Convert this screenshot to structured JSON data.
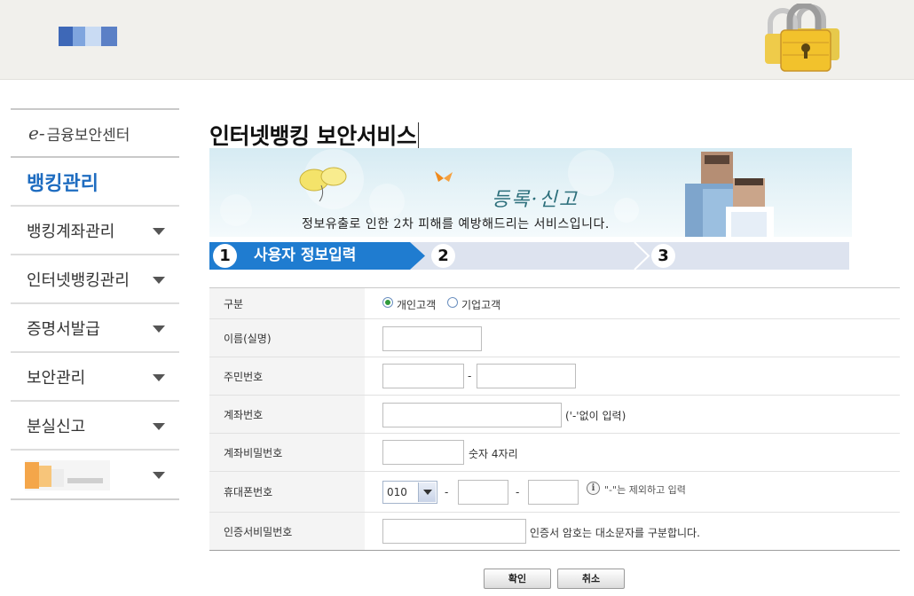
{
  "header": {
    "logo_icon": "kfta-logo",
    "lock_icon": "padlock-icon"
  },
  "sidebar": {
    "heading_prefix": "e-",
    "heading": "금융보안센터",
    "section_title": "뱅킹관리",
    "items": [
      {
        "label": "뱅킹계좌관리"
      },
      {
        "label": "인터넷뱅킹관리"
      },
      {
        "label": "증명서발급"
      },
      {
        "label": "보안관리"
      },
      {
        "label": "분실신고"
      }
    ],
    "banner_icon": "site-banner"
  },
  "main": {
    "title": "인터넷뱅킹 보안서비스",
    "hero": {
      "heading": "등록·신고",
      "description": "정보유출로 인한 2차 피해를 예방해드리는 서비스입니다."
    },
    "steps": [
      {
        "number": "1",
        "label": "사용자 정보입력",
        "active": true
      },
      {
        "number": "2",
        "label": ""
      },
      {
        "number": "3",
        "label": ""
      }
    ]
  },
  "form": {
    "rows": {
      "type": {
        "label": "구분",
        "options": [
          {
            "label": "개인고객",
            "selected": true
          },
          {
            "label": "기업고객",
            "selected": false
          }
        ]
      },
      "name": {
        "label": "이름(실명)",
        "value": ""
      },
      "resident": {
        "label": "주민번호",
        "value1": "",
        "value2": "",
        "separator": "-"
      },
      "account": {
        "label": "계좌번호",
        "value": "",
        "hint": "('-'없이 입력)"
      },
      "account_pw": {
        "label": "계좌비밀번호",
        "value": "",
        "hint": "숫자 4자리"
      },
      "phone": {
        "label": "휴대폰번호",
        "prefix": "010",
        "value2": "",
        "value3": "",
        "separator": "-",
        "hint": "\"-\"는 제외하고 입력"
      },
      "cert_pw": {
        "label": "인증서비밀번호",
        "value": "",
        "hint": "인증서 암호는 대소문자를 구분합니다."
      }
    }
  },
  "buttons": {
    "confirm": "확인",
    "cancel": "취소"
  },
  "colors": {
    "accent": "#1f7cd0",
    "sidebar_title": "#1e6cc0",
    "steps_bg": "#dde3ef"
  }
}
